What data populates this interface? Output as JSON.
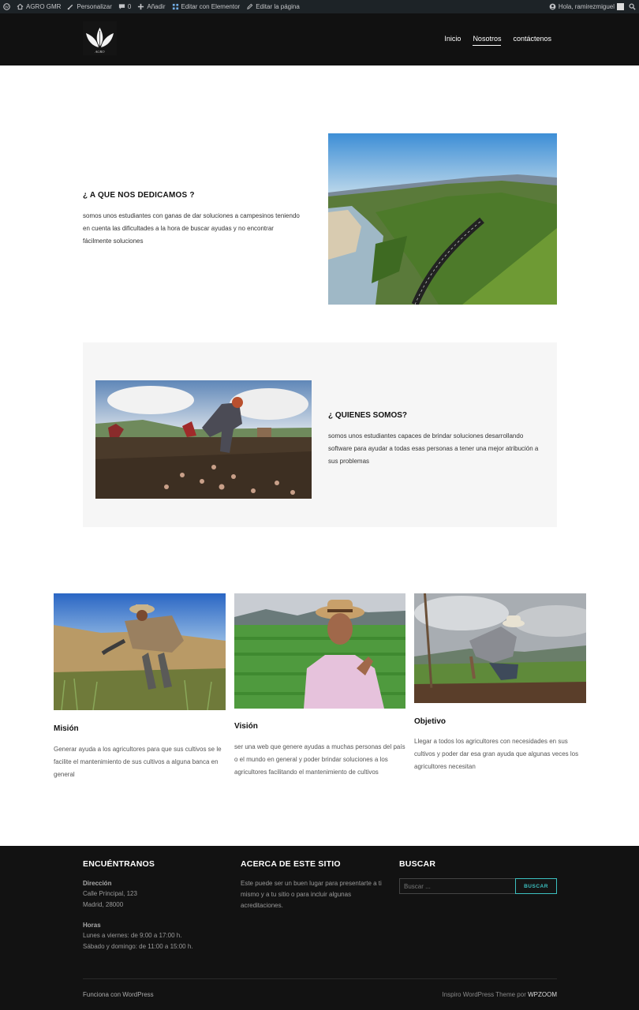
{
  "admin_bar": {
    "site_name": "AGRO GMR",
    "customize": "Personalizar",
    "comments_count": "0",
    "new": "Añadir",
    "edit_with": "Editar con Elementor",
    "edit_page": "Editar la página",
    "greeting": "Hola, ramirezmiguel"
  },
  "header": {
    "logo_text": "AGRO",
    "nav": [
      "Inicio",
      "Nosotros",
      "contáctenos"
    ],
    "active_nav": "Nosotros"
  },
  "section_what": {
    "title": "¿ A QUE NOS DEDICAMOS ?",
    "text": "somos unos estudiantes con ganas de dar soluciones a campesinos teniendo en cuenta las dificultades a la hora de buscar ayudas y no encontrar fácilmente soluciones"
  },
  "section_who": {
    "title": "¿ QUIENES SOMOS?",
    "text": "somos unos estudiantes capaces de brindar soluciones desarrollando software para ayudar a todas esas personas a tener una mejor atribución a sus problemas"
  },
  "cards": [
    {
      "title": "Misión",
      "text": "Generar ayuda a los agricultores para que sus cultivos se le facilite el mantenimiento de sus cultivos a alguna banca en general"
    },
    {
      "title": "Visión",
      "text": "ser una web que genere ayudas a muchas personas del país o el mundo en general y poder brindar soluciones a los agricultores facilitando el mantenimiento de cultivos"
    },
    {
      "title": "Objetivo",
      "text": "Llegar a todos los agricultores con necesidades en sus cultivos y poder dar esa gran ayuda que algunas veces los agricultores necesitan"
    }
  ],
  "footer": {
    "find_us": {
      "heading": "ENCUÉNTRANOS",
      "address_label": "Dirección",
      "address_line1": "Calle Principal, 123",
      "address_line2": "Madrid, 28000",
      "hours_label": "Horas",
      "hours_line1": "Lunes a viernes: de 9:00 a 17:00 h.",
      "hours_line2": "Sábado y domingo: de 11:00 a 15:00 h."
    },
    "about": {
      "heading": "ACERCA DE ESTE SITIO",
      "text": "Este puede ser un buen lugar para presentarte a ti mismo y a tu sitio o para incluir algunas acreditaciones."
    },
    "search": {
      "heading": "BUSCAR",
      "placeholder": "Buscar ...",
      "button": "BUSCAR"
    },
    "bottom_left": "Funciona con WordPress",
    "bottom_right_prefix": "Inspiro WordPress Theme por",
    "bottom_right_brand": "WPZOOM"
  }
}
